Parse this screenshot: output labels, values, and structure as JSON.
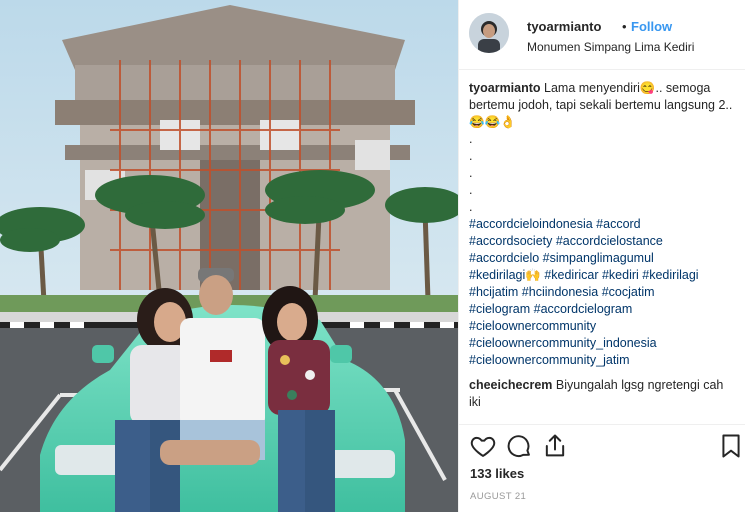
{
  "post": {
    "username": "tyoarmianto",
    "separator": "•",
    "follow_label": "Follow",
    "location": "Monumen Simpang Lima Kediri"
  },
  "caption": {
    "username": "tyoarmianto",
    "text": "Lama menyendiri😋.. semoga bertemu jodoh, tapi sekali bertemu langsung 2..😂😂👌",
    "dots": [
      ".",
      ".",
      ".",
      ".",
      "."
    ],
    "hashtags": [
      "#accordcieloindonesia #accord",
      "#accordsociety #accordcielostance",
      "#accordcielo #simpanglimagumul",
      "#kedirilagi🙌 #kediricar #kediri #kedirilagi",
      "#hcijatim #hciindonesia #cocjatim",
      "#cielogram #accordcielogram",
      "#cieloownercommunity",
      "#cieloownercommunity_indonesia",
      "#cieloownercommunity_jatim"
    ]
  },
  "comment": {
    "username": "cheeichecrem",
    "text": "Biyungalah lgsg ngretengi cah iki"
  },
  "actions": {
    "like_icon": "heart-icon",
    "comment_icon": "comment-bubble-icon",
    "share_icon": "share-icon",
    "save_icon": "bookmark-icon"
  },
  "likes": "133 likes",
  "date": "AUGUST 21",
  "colors": {
    "link": "#003569",
    "follow": "#3897f0",
    "car": "#5fd3b6",
    "text": "#262626",
    "muted": "#999999"
  }
}
